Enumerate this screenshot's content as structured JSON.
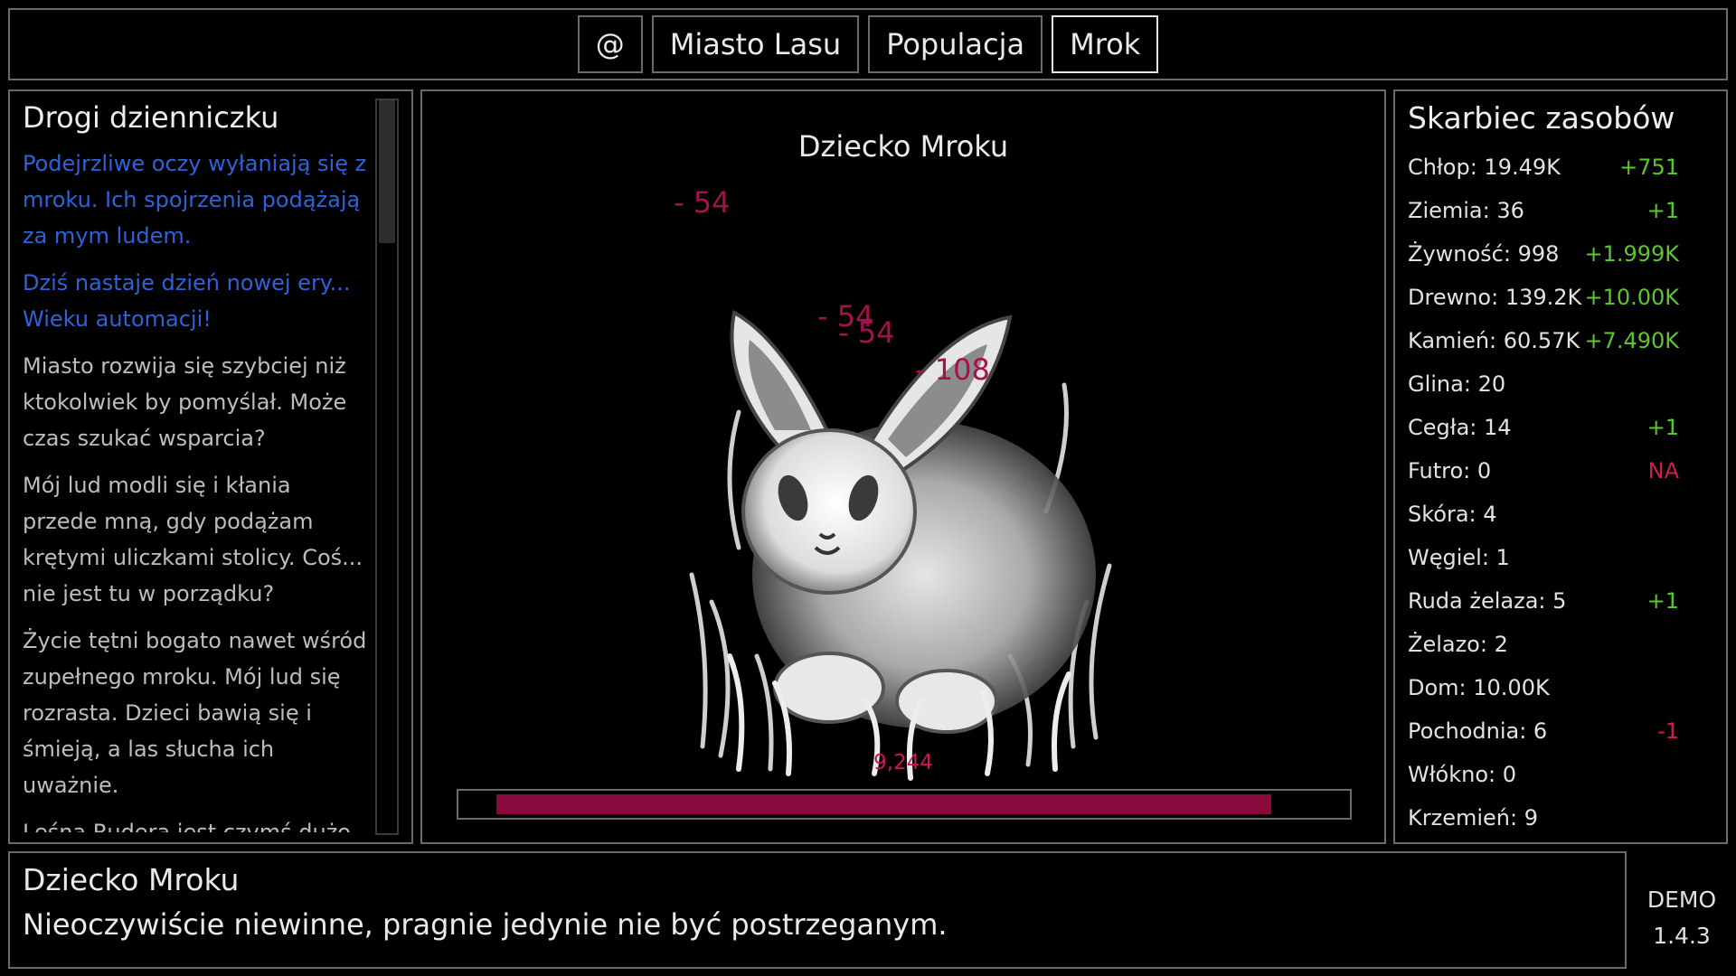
{
  "tabs": [
    {
      "label": "@"
    },
    {
      "label": "Miasto Lasu"
    },
    {
      "label": "Populacja"
    },
    {
      "label": "Mrok",
      "active": true
    }
  ],
  "journal": {
    "title": "Drogi dzienniczku",
    "entries": [
      {
        "text": "Podejrzliwe oczy wyłaniają się z mroku. Ich spojrzenia podążają za mym ludem.",
        "color": "#2f62d9"
      },
      {
        "text": "Dziś nastaje dzień nowej ery... Wieku automacji!",
        "color": "#2f62d9"
      },
      {
        "text": "Miasto rozwija się szybciej niż ktokolwiek by pomyślał. Może czas szukać wsparcia?"
      },
      {
        "text": "Mój lud modli się i kłania przede mną, gdy podążam krętymi uliczkami stolicy. Coś... nie jest tu w porządku?"
      },
      {
        "text": "Życie tętni bogato nawet wśród zupełnego mroku. Mój lud się rozrasta. Dzieci bawią się i śmieją, a las słucha ich uważnie."
      },
      {
        "text": "Leśna Rudera jest czymś dużo lepszym od poprzedniego"
      }
    ]
  },
  "battle": {
    "enemy_name": "Dziecko Mroku",
    "damage_numbers": [
      "- 54",
      "- 54",
      "- 54",
      "- 108"
    ],
    "hp_text": "9,244",
    "hp_fraction": 0.95,
    "hp_color": "#8a0a3e"
  },
  "resources": {
    "title": "Skarbiec zasobów",
    "items": [
      {
        "label": "Chłop: 19.49K",
        "delta": "+751",
        "tone": "pos"
      },
      {
        "label": "Ziemia: 36",
        "delta": "+1",
        "tone": "pos"
      },
      {
        "label": "Żywność: 998",
        "delta": "+1.999K",
        "tone": "pos"
      },
      {
        "label": "Drewno: 139.2K",
        "delta": "+10.00K",
        "tone": "pos"
      },
      {
        "label": "Kamień: 60.57K",
        "delta": "+7.490K",
        "tone": "pos"
      },
      {
        "label": "Glina: 20",
        "delta": "",
        "tone": ""
      },
      {
        "label": "Cegła: 14",
        "delta": "+1",
        "tone": "pos"
      },
      {
        "label": "Futro: 0",
        "delta": "NA",
        "tone": "neg"
      },
      {
        "label": "Skóra: 4",
        "delta": "",
        "tone": ""
      },
      {
        "label": "Węgiel: 1",
        "delta": "",
        "tone": ""
      },
      {
        "label": "Ruda żelaza: 5",
        "delta": "+1",
        "tone": "pos"
      },
      {
        "label": "Żelazo: 2",
        "delta": "",
        "tone": ""
      },
      {
        "label": "Dom: 10.00K",
        "delta": "",
        "tone": ""
      },
      {
        "label": "Pochodnia: 6",
        "delta": "-1",
        "tone": "neg"
      },
      {
        "label": "Włókno: 0",
        "delta": "",
        "tone": ""
      },
      {
        "label": "Krzemień: 9",
        "delta": "",
        "tone": ""
      }
    ]
  },
  "info": {
    "title": "Dziecko Mroku",
    "description": "Nieoczywiście niewinne, pragnie jedynie nie być postrzeganym."
  },
  "version": {
    "label": "DEMO",
    "number": "1.4.3"
  },
  "colors": {
    "positive": "#5cc72c",
    "negative": "#d01c55",
    "journal_blue": "#2f62d9"
  },
  "icons": [
    "white-rabbit-creature-illustration"
  ]
}
